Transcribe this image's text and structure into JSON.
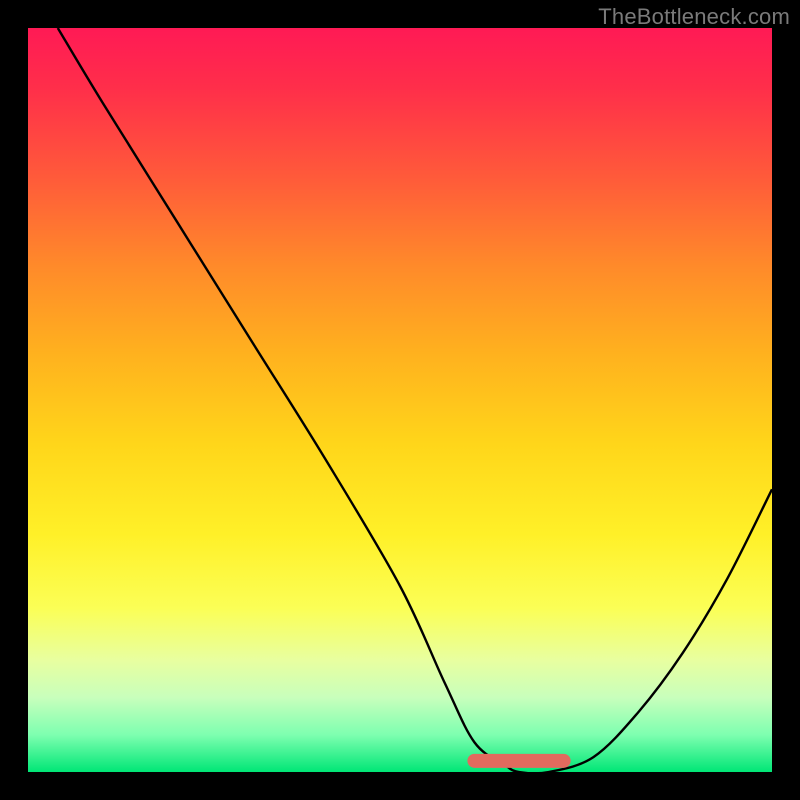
{
  "watermark": "TheBottleneck.com",
  "colors": {
    "frame": "#000000",
    "curve": "#000000",
    "marker": "#e26a5e"
  },
  "chart_data": {
    "type": "line",
    "title": "",
    "xlabel": "",
    "ylabel": "",
    "xlim": [
      0,
      100
    ],
    "ylim": [
      0,
      100
    ],
    "grid": false,
    "legend": false,
    "series": [
      {
        "name": "bottleneck-curve",
        "x": [
          4,
          10,
          20,
          30,
          40,
          50,
          56,
          60,
          64,
          66,
          70,
          76,
          82,
          88,
          94,
          100
        ],
        "y": [
          100,
          90,
          74,
          58,
          42,
          25,
          12,
          4,
          1,
          0,
          0,
          2,
          8,
          16,
          26,
          38
        ]
      }
    ],
    "annotations": [
      {
        "name": "optimal-range-marker",
        "x": [
          60,
          72
        ],
        "y": [
          1.5,
          1.5
        ]
      }
    ]
  }
}
